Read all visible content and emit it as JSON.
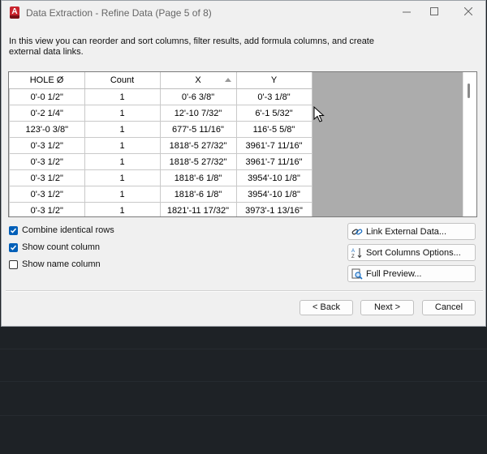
{
  "window": {
    "title": "Data Extraction - Refine Data (Page 5 of 8)",
    "app_icon_letter": "A"
  },
  "description": "In this view you can reorder and sort columns, filter results, add formula columns, and create external data links.",
  "table": {
    "columns": [
      "HOLE Ø",
      "Count",
      "X",
      "Y"
    ],
    "sorted_column": "X",
    "rows": [
      [
        "0'-0 1/2\"",
        "1",
        "0'-6 3/8\"",
        "0'-3 1/8\""
      ],
      [
        "0'-2 1/4\"",
        "1",
        "12'-10 7/32\"",
        "6'-1 5/32\""
      ],
      [
        "123'-0 3/8\"",
        "1",
        "677'-5 11/16\"",
        "116'-5 5/8\""
      ],
      [
        "0'-3 1/2\"",
        "1",
        "1818'-5 27/32\"",
        "3961'-7 11/16\""
      ],
      [
        "0'-3 1/2\"",
        "1",
        "1818'-5 27/32\"",
        "3961'-7 11/16\""
      ],
      [
        "0'-3 1/2\"",
        "1",
        "1818'-6 1/8\"",
        "3954'-10 1/8\""
      ],
      [
        "0'-3 1/2\"",
        "1",
        "1818'-6 1/8\"",
        "3954'-10 1/8\""
      ],
      [
        "0'-3 1/2\"",
        "1",
        "1821'-11 17/32\"",
        "3973'-1 13/16\""
      ]
    ]
  },
  "options": {
    "combine_rows": {
      "label": "Combine identical rows",
      "checked": true
    },
    "show_count": {
      "label": "Show count column",
      "checked": true
    },
    "show_name": {
      "label": "Show name column",
      "checked": false
    }
  },
  "side_buttons": {
    "link_external": "Link External Data...",
    "sort_options": "Sort Columns Options...",
    "full_preview": "Full Preview..."
  },
  "footer": {
    "back": "< Back",
    "next": "Next >",
    "cancel": "Cancel"
  },
  "colors": {
    "accent": "#005fb8",
    "app_icon": "#c8232c",
    "desktop": "#1e2226"
  }
}
